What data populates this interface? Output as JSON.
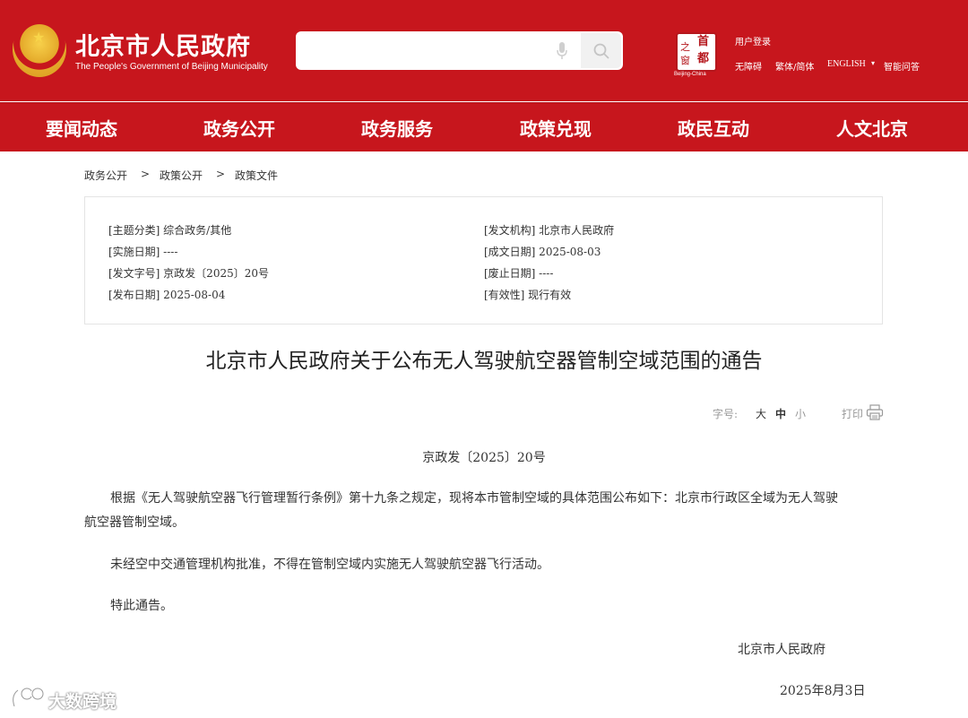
{
  "header": {
    "brand_cn": "北京市人民政府",
    "brand_en": "The People's Government of Beijing Municipality",
    "search_placeholder": "",
    "capital_logo_glyphs": [
      "首",
      "都",
      "之",
      "窗"
    ],
    "capital_logo_sub": "Beijing-China",
    "user_login": "用户登录",
    "accessibility": "无障碍",
    "traditional_simplified": "繁体/简体",
    "english": "ENGLISH",
    "english_caret": "▾",
    "smart_qa": "智能问答"
  },
  "nav": [
    "要闻动态",
    "政务公开",
    "政务服务",
    "政策兑现",
    "政民互动",
    "人文北京"
  ],
  "breadcrumb": {
    "items": [
      "政务公开",
      "政策公开",
      "政策文件"
    ],
    "separator": ">"
  },
  "info": {
    "topic": "[主题分类] 综合政务/其他",
    "issuer": "[发文机构] 北京市人民政府",
    "effective_date": "[实施日期] ----",
    "written_date": "[成文日期] 2025-08-03",
    "doc_number": "[发文字号] 京政发〔2025〕20号",
    "repeal_date": "[废止日期] ----",
    "publish_date": "[发布日期] 2025-08-04",
    "validity": "[有效性] 现行有效"
  },
  "article": {
    "title": "北京市人民政府关于公布无人驾驶航空器管制空域范围的通告",
    "doc_no": "京政发〔2025〕20号",
    "para1_line1": "根据《无人驾驶航空器飞行管理暂行条例》第十九条之规定，现将本市管制空域的具体范围公布如下：北京市行政区全域为无人驾驶",
    "para1_line2": "航空器管制空域。",
    "para2": "未经空中交通管理机构批准，不得在管制空域内实施无人驾驶航空器飞行活动。",
    "para3": "特此通告。",
    "signer": "北京市人民政府",
    "sign_date": "2025年8月3日"
  },
  "tools": {
    "font_size_label": "字号:",
    "large": "大",
    "medium": "中",
    "small": "小",
    "print": "打印"
  },
  "watermark": {
    "text": "大数跨境"
  },
  "colors": {
    "brand_red": "#c7161d",
    "gold": "#f8d54a"
  }
}
